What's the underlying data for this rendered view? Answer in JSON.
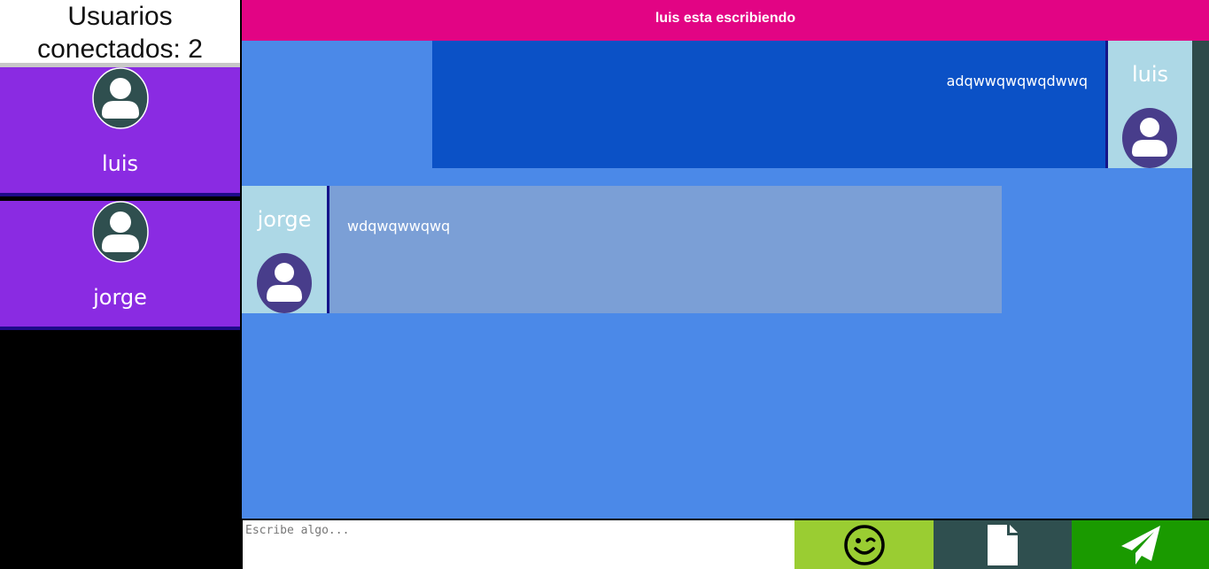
{
  "sidebar": {
    "title_line1": "Usuarios",
    "title_line2": "conectados: 2",
    "users": [
      {
        "name": "luis",
        "icon": "user-avatar-icon"
      },
      {
        "name": "jorge",
        "icon": "user-avatar-icon"
      }
    ]
  },
  "topbar": {
    "typing_status": "luis esta escribiendo"
  },
  "chat": {
    "messages": [
      {
        "author": "luis",
        "text": "adqwwqwqwqdwwq",
        "side": "right"
      },
      {
        "author": "jorge",
        "text": "wdqwqwwqwq",
        "side": "left"
      }
    ]
  },
  "composer": {
    "placeholder": "Escribe algo...",
    "emoji_icon": "wink-emoji-icon",
    "file_icon": "file-icon",
    "send_icon": "send-icon"
  },
  "colors": {
    "sidebar_card": "#8a2be2",
    "topbar": "#e20484",
    "chat_bg": "#4b89e8",
    "mine_bubble": "#0b51c6",
    "other_bubble": "#7b9fd6",
    "author_panel": "#add8e6",
    "emoji_button": "#9acd32",
    "file_button": "#2f4f4f",
    "send_button": "#1a9a00"
  }
}
